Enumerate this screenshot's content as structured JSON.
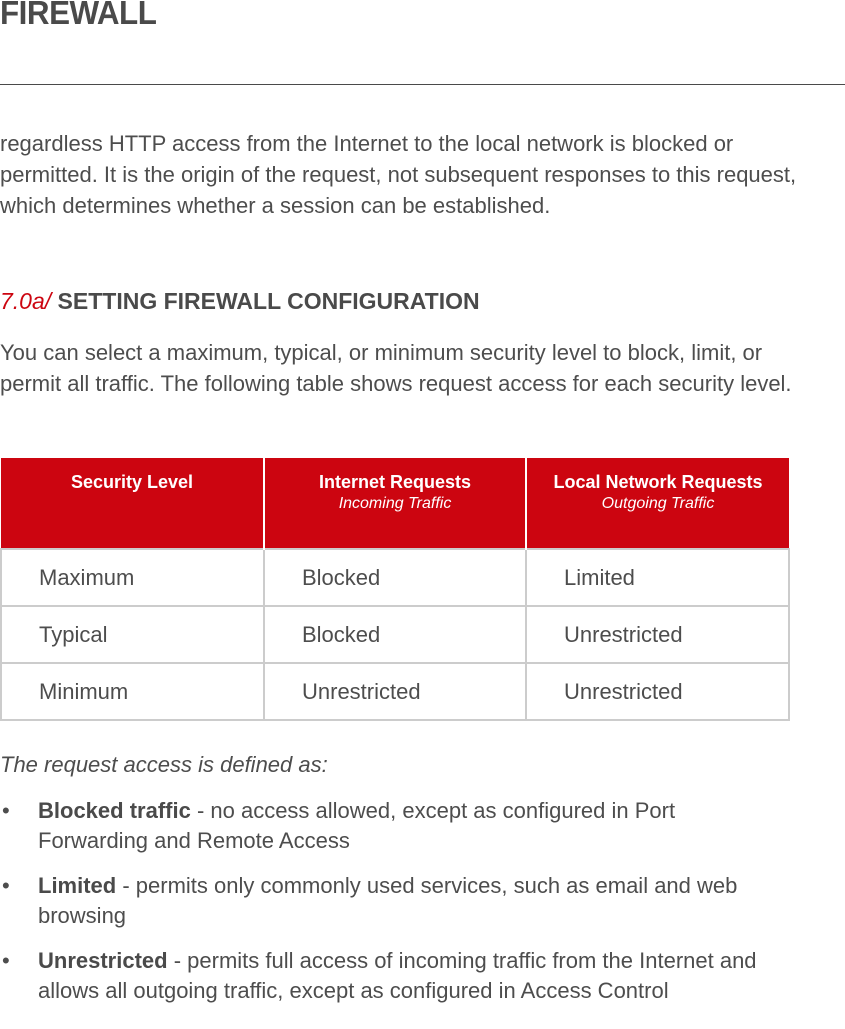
{
  "page": {
    "title": "FIREWALL"
  },
  "intro_paragraph": "regardless HTTP access from the Internet to the local network is blocked or permitted. It is the origin of the request, not subsequent responses to this request, which determines whether a session can be established.",
  "section": {
    "number": "7.0a/",
    "heading": "SETTING FIREWALL CONFIGURATION",
    "paragraph": "You can select a maximum, typical, or minimum security level to block, limit, or permit all traffic. The following table shows request access for each security level."
  },
  "table": {
    "headers": [
      {
        "label": "Security Level",
        "sub": ""
      },
      {
        "label": "Internet Requests",
        "sub": "Incoming Traffic"
      },
      {
        "label": "Local Network Requests",
        "sub": "Outgoing Traffic"
      }
    ],
    "rows": [
      [
        "Maximum",
        "Blocked",
        "Limited"
      ],
      [
        "Typical",
        "Blocked",
        "Unrestricted"
      ],
      [
        "Minimum",
        "Unrestricted",
        "Unrestricted"
      ]
    ]
  },
  "definitions": {
    "intro": "The request access is defined as:",
    "bullet_glyph": "•",
    "items": [
      {
        "term": "Blocked traffic",
        "text": " - no access allowed, except as configured in Port Forwarding and Remote Access"
      },
      {
        "term": "Limited",
        "text": " - permits only commonly used services, such as email and web browsing"
      },
      {
        "term": "Unrestricted",
        "text": " - permits full access of incoming traffic from the Internet and allows all outgoing traffic, except as configured in Access Control"
      }
    ]
  },
  "colors": {
    "accent_red": "#cc0510",
    "text_gray": "#4d4d4d",
    "border_gray": "#cccccc"
  }
}
